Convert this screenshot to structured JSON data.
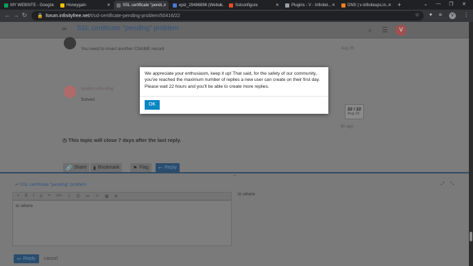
{
  "browser": {
    "tabs": [
      {
        "label": "MY WEBSITE - Googl...",
        "fav_color": "#0f9d58",
        "active": false
      },
      {
        "label": "Honeygain",
        "fav_color": "#f2c200",
        "active": false
      },
      {
        "label": "SSL certificate \"pendi...",
        "fav_color": "#6f6f6f",
        "active": true
      },
      {
        "label": "epiz_29486896 (Websi...",
        "fav_color": "#4a7bd0",
        "active": false
      },
      {
        "label": "Sslconfigure",
        "fav_color": "#ea4d2c",
        "active": false
      },
      {
        "label": "Plugins - V - Infinitel...",
        "fav_color": "#9aa0a6",
        "active": false
      },
      {
        "label": "DNS | v-infiniteups.in...",
        "fav_color": "#f38020",
        "active": false
      }
    ],
    "new_tab": "+",
    "window_controls": [
      "⌄",
      "—",
      "❐",
      "✕"
    ],
    "url_host": "forum.infinityfree.net",
    "url_path": "/t/ssl-certificate-pending-problem/50416/22",
    "profile_initial": "V"
  },
  "topic": {
    "title": "SSL certificate \"pending\" problem",
    "user_initial": "V"
  },
  "posts": [
    {
      "text": "You need to insert another CNAME record",
      "date": "Aug 26",
      "avatar_color": "#3a3a3a"
    },
    {
      "text": "Solved",
      "author": "system-info-blog",
      "date": "Aug 26",
      "avatar_color": "#b06a6a"
    }
  ],
  "progress": {
    "current": "22 / 22",
    "date": "Aug 26",
    "ago": "8h ago"
  },
  "close_notice": "This topic will close 7 days after the last reply.",
  "actions": {
    "share": "Share",
    "bookmark": "Bookmark",
    "flag": "Flag",
    "reply": "Reply"
  },
  "composer": {
    "reply_to": "SSL certificate \"pending\" problem",
    "editor_text": "to where",
    "preview_text": "to where",
    "reply_label": "Reply",
    "cancel_label": "cancel"
  },
  "modal": {
    "message": "We appreciate your enthusiasm, keep it up! That said, for the safety of our community, you've reached the maximum number of replies a new user can create on their first day. Please wait 22 hours and you'll be able to create more replies.",
    "ok_label": "OK"
  }
}
